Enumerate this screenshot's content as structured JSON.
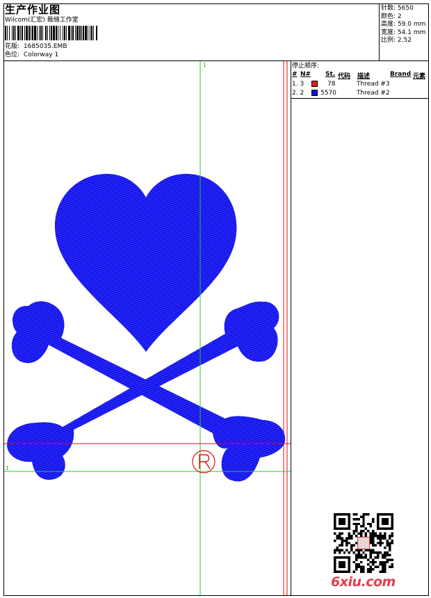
{
  "header": {
    "title": "生产作业图",
    "company": "Wilcom(汇宏) 裁缝工作室",
    "design_label": "花版:",
    "design_value": "1685035.EMB",
    "colorway_label": "色位:",
    "colorway_value": "Colorway 1"
  },
  "stats": {
    "stitches_label": "针数:",
    "stitches_value": "5650",
    "colors_label": "颜色:",
    "colors_value": "2",
    "height_label": "高度:",
    "height_value": "59.0 mm",
    "width_label": "宽度:",
    "width_value": "54.1 mm",
    "ratio_label": "比例:",
    "ratio_value": "2.52"
  },
  "sequence": {
    "heading": "停止顺序:",
    "columns": {
      "num": "#",
      "needle": "N#",
      "st": "St.",
      "code": "代码",
      "desc": "描述",
      "brand": "Brand",
      "element": "元素"
    },
    "rows": [
      {
        "num": "1. 3",
        "color": "#e8191c",
        "code": "78",
        "desc": "Thread #3"
      },
      {
        "num": "2. 2",
        "color": "#1010f0",
        "code": "5570",
        "desc": "Thread #2"
      }
    ]
  },
  "canvas": {
    "marker_top": "1",
    "marker_left": "1",
    "design_color": "#1010ee",
    "guide_color": "#22cc22",
    "frame_color": "#dd1111"
  },
  "watermark": "6xiu.com"
}
